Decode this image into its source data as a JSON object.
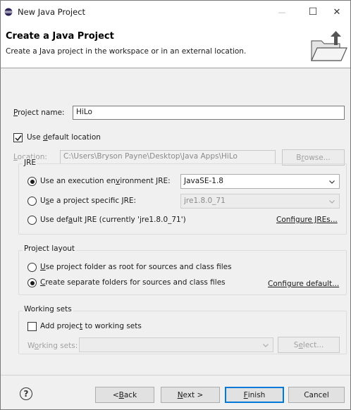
{
  "window": {
    "title": "New Java Project",
    "controls": {
      "minimize": "—",
      "maximize": "☐",
      "close": "✕"
    }
  },
  "banner": {
    "title": "Create a Java Project",
    "description": "Create a Java project in the workspace or in an external location."
  },
  "project": {
    "name_label_accel": "P",
    "name_label_rest": "roject name:",
    "name_value": "HiLo",
    "use_default_checked": true,
    "use_default_pre": "Use ",
    "use_default_accel": "d",
    "use_default_post": "efault location",
    "location_label_accel": "L",
    "location_label_rest": "ocation:",
    "location_value": "C:\\Users\\Bryson Payne\\Desktop\\Java Apps\\HiLo",
    "browse_pre": "B",
    "browse_accel": "r",
    "browse_post": "owse..."
  },
  "jre": {
    "group_title": "JRE",
    "opt_env_pre": "Use an execution en",
    "opt_env_accel": "v",
    "opt_env_post": "ironment JRE:",
    "env_value": "JavaSE-1.8",
    "opt_specific_pre": "U",
    "opt_specific_accel": "s",
    "opt_specific_post": "e a project specific JRE:",
    "specific_value": "jre1.8.0_71",
    "opt_default_pre": "Use def",
    "opt_default_accel": "a",
    "opt_default_post": "ult JRE (currently 'jre1.8.0_71')",
    "configure_jres": "Configure JREs...",
    "selected": "env"
  },
  "layout": {
    "group_title": "Project layout",
    "opt_root_accel": "U",
    "opt_root_rest": "se project folder as root for sources and class files",
    "opt_separate_accel": "C",
    "opt_separate_rest": "reate separate folders for sources and class files",
    "configure_default": "Configure default...",
    "selected": "separate"
  },
  "working_sets": {
    "group_title": "Working sets",
    "add_pre": "Add projec",
    "add_accel": "t",
    "add_post": " to working sets",
    "add_checked": false,
    "label_pre": "W",
    "label_accel": "o",
    "label_post": "rking sets:",
    "value": "",
    "select_pre": "S",
    "select_accel": "e",
    "select_post": "lect..."
  },
  "footer": {
    "help": "?",
    "back_pre": "< ",
    "back_accel": "B",
    "back_post": "ack",
    "next_accel": "N",
    "next_post": "ext >",
    "finish_accel": "F",
    "finish_post": "inish",
    "cancel": "Cancel"
  },
  "colors": {
    "focus_border": "#0078d7",
    "disabled_text": "#a0a0a0",
    "window_bg": "#f0f0f0"
  }
}
